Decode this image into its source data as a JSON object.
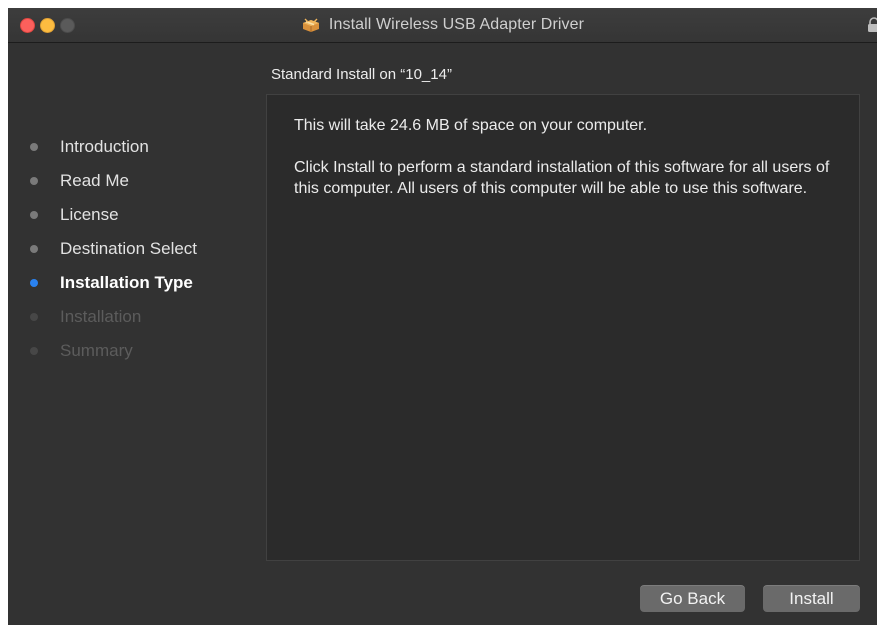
{
  "window": {
    "title": "Install Wireless USB Adapter Driver",
    "title_icon": "package-icon",
    "lock_icon": "lock-icon"
  },
  "sidebar": {
    "steps": [
      {
        "label": "Introduction",
        "state": "done"
      },
      {
        "label": "Read Me",
        "state": "done"
      },
      {
        "label": "License",
        "state": "done"
      },
      {
        "label": "Destination Select",
        "state": "done"
      },
      {
        "label": "Installation Type",
        "state": "current"
      },
      {
        "label": "Installation",
        "state": "future"
      },
      {
        "label": "Summary",
        "state": "future"
      }
    ]
  },
  "main": {
    "section_title": "Standard Install on “10_14”",
    "paragraph1": "This will take 24.6 MB of space on your computer.",
    "paragraph2": "Click Install to perform a standard installation of this software for all users of this computer. All users of this computer will be able to use this software."
  },
  "buttons": {
    "go_back": "Go Back",
    "install": "Install"
  },
  "colors": {
    "window_bg": "#323232",
    "content_bg": "#2b2b2b",
    "current_step_dot": "#2a82f0",
    "close": "#fc605c",
    "minimize": "#fdbc40"
  }
}
